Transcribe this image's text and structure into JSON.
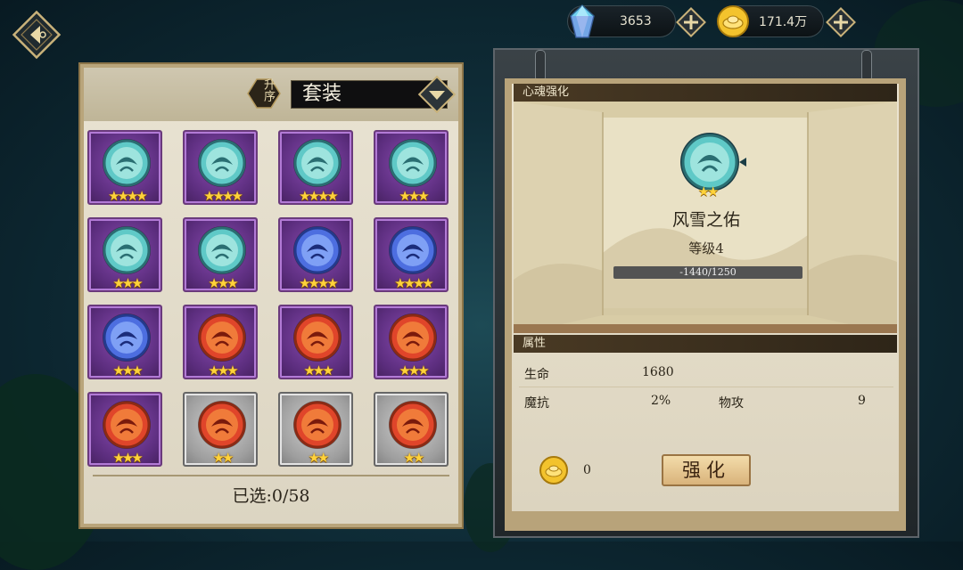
{
  "topbar": {
    "crystal": {
      "value": "3653",
      "icon": "crystal-icon",
      "color": "#7ed8f0"
    },
    "gold": {
      "value": "171.4万",
      "icon": "gold-ingot-icon",
      "color": "#f2c230"
    }
  },
  "left_panel": {
    "sort_label": "升序",
    "filter_value": "套装",
    "selected_text": "已选:0/58",
    "slots": [
      {
        "element": "wind",
        "stars": "★★★★",
        "frame": "purple"
      },
      {
        "element": "wind",
        "stars": "★★★★",
        "frame": "purple"
      },
      {
        "element": "wind",
        "stars": "★★★★",
        "frame": "purple"
      },
      {
        "element": "wind",
        "stars": "★★★",
        "frame": "purple"
      },
      {
        "element": "wind",
        "stars": "★★★",
        "frame": "purple"
      },
      {
        "element": "wind",
        "stars": "★★★",
        "frame": "purple"
      },
      {
        "element": "water",
        "stars": "★★★★",
        "frame": "purple"
      },
      {
        "element": "water",
        "stars": "★★★★",
        "frame": "purple"
      },
      {
        "element": "water",
        "stars": "★★★",
        "frame": "purple"
      },
      {
        "element": "fire",
        "stars": "★★★",
        "frame": "purple"
      },
      {
        "element": "fire",
        "stars": "★★★",
        "frame": "purple"
      },
      {
        "element": "fire",
        "stars": "★★★",
        "frame": "purple"
      },
      {
        "element": "fire",
        "stars": "★★★",
        "frame": "purple"
      },
      {
        "element": "fire",
        "stars": "★★",
        "frame": "gray"
      },
      {
        "element": "fire",
        "stars": "★★",
        "frame": "gray"
      },
      {
        "element": "fire",
        "stars": "★★",
        "frame": "gray"
      }
    ]
  },
  "right_panel": {
    "section_title": "心魂强化",
    "item_name": "风雪之佑",
    "item_stars": "★★",
    "level_text": "等级4",
    "xp_text": "-1440/1250",
    "attr_section_title": "属性",
    "attributes": [
      {
        "label": "生命",
        "value": "1680"
      },
      {
        "label": "魔抗",
        "value": "2%"
      },
      {
        "label": "物攻",
        "value": "9"
      }
    ],
    "cost_value": "0",
    "strengthen_label": "强化"
  }
}
